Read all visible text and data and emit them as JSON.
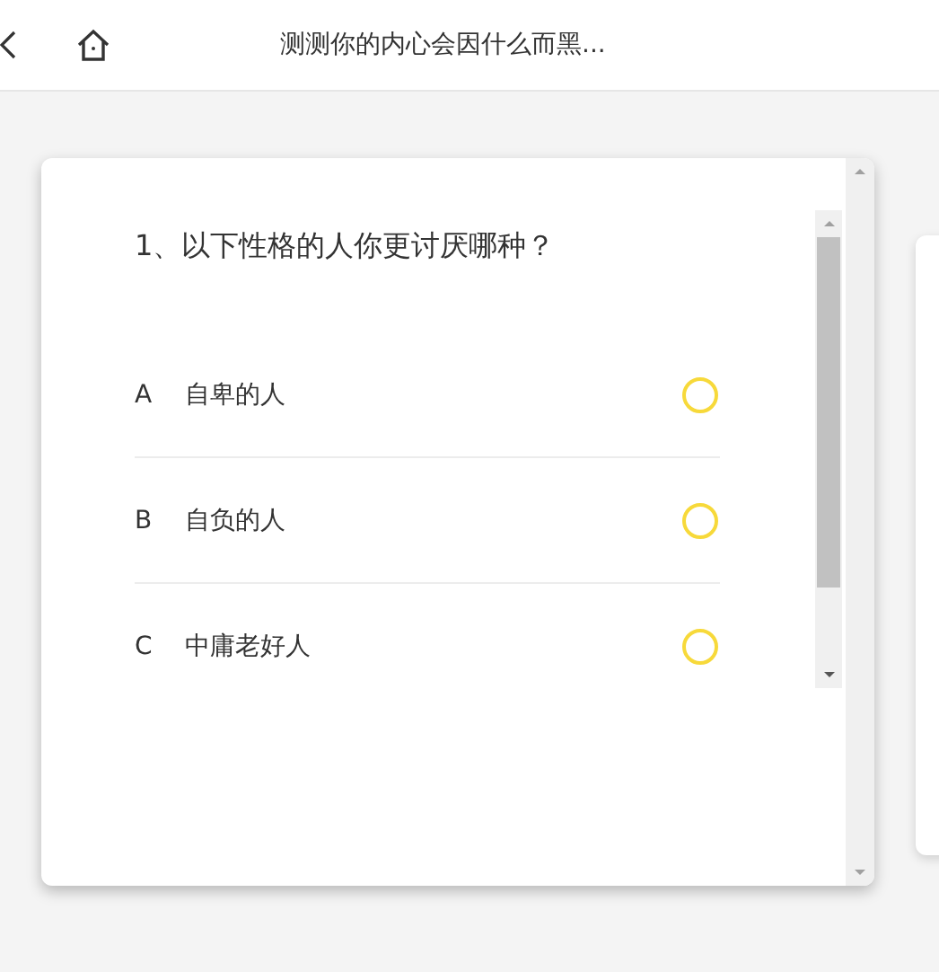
{
  "header": {
    "title": "测测你的内心会因什么而黑..."
  },
  "question": {
    "text": "1、以下性格的人你更讨厌哪种？",
    "options": [
      {
        "letter": "A",
        "label": "自卑的人",
        "selected": false
      },
      {
        "letter": "B",
        "label": "自负的人",
        "selected": false
      },
      {
        "letter": "C",
        "label": "中庸老好人",
        "selected": false
      }
    ]
  }
}
